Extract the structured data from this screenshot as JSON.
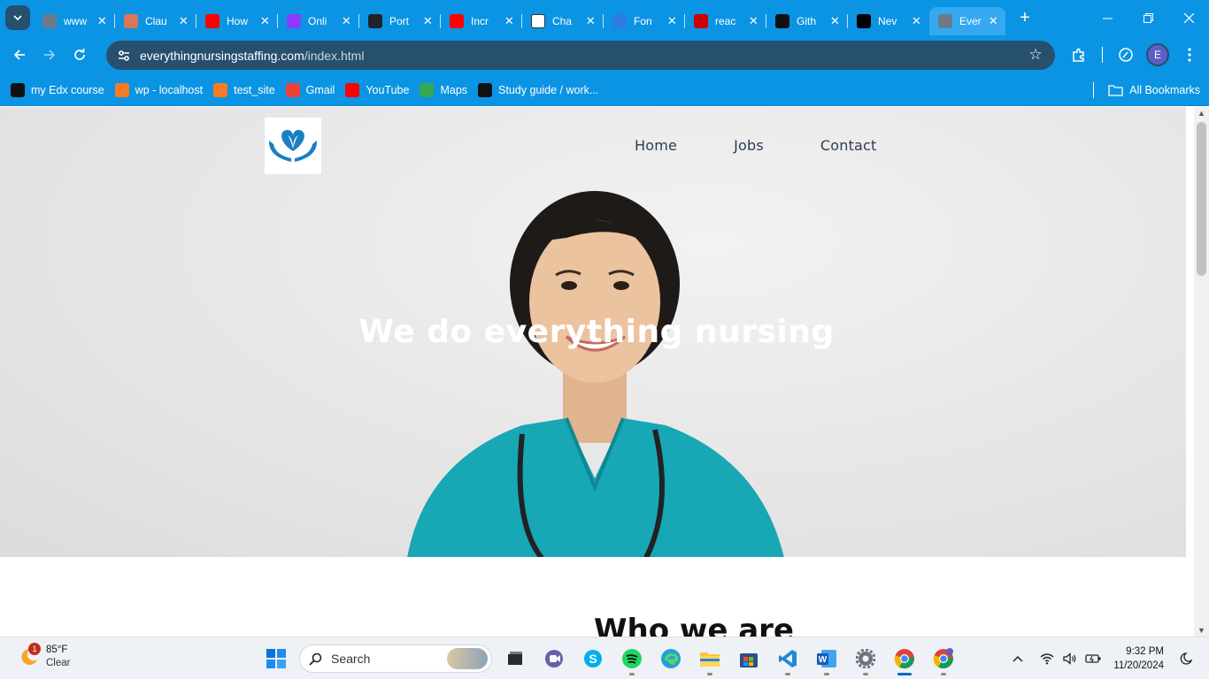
{
  "tabs": [
    {
      "title": "www",
      "favicon": "globe-icon",
      "color": "#6b7b88"
    },
    {
      "title": "Clau",
      "favicon": "claude-icon",
      "color": "#d97757"
    },
    {
      "title": "How",
      "favicon": "youtube-icon",
      "color": "#ff0000"
    },
    {
      "title": "Onli",
      "favicon": "purple-circle-icon",
      "color": "#8b3dff"
    },
    {
      "title": "Port",
      "favicon": "react-icon",
      "color": "#20232a"
    },
    {
      "title": "Incr",
      "favicon": "youtube-icon",
      "color": "#ff0000"
    },
    {
      "title": "Cha",
      "favicon": "chatgpt-icon",
      "color": "#ffffff"
    },
    {
      "title": "Fon",
      "favicon": "flag-icon",
      "color": "#2f7be5"
    },
    {
      "title": "reac",
      "favicon": "n-icon",
      "color": "#cc0000"
    },
    {
      "title": "Gith",
      "favicon": "github-icon",
      "color": "#111111"
    },
    {
      "title": "Nev",
      "favicon": "triangle-icon",
      "color": "#000000"
    },
    {
      "title": "Ever",
      "favicon": "globe-icon",
      "color": "#6b7b88",
      "active": true
    }
  ],
  "address": {
    "domain": "everythingnursingstaffing.com",
    "path": "/index.html"
  },
  "profile_initial": "E",
  "bookmarks": [
    {
      "label": "my Edx course",
      "icon": "x-icon",
      "color": "#111111"
    },
    {
      "label": "wp - localhost",
      "icon": "xampp-icon",
      "color": "#fb7a24"
    },
    {
      "label": "test_site",
      "icon": "xampp-icon",
      "color": "#fb7a24"
    },
    {
      "label": "Gmail",
      "icon": "gmail-icon",
      "color": "#ea4335"
    },
    {
      "label": "YouTube",
      "icon": "youtube-icon",
      "color": "#ff0000"
    },
    {
      "label": "Maps",
      "icon": "maps-icon",
      "color": "#34a853"
    },
    {
      "label": "Study guide / work...",
      "icon": "institution-icon",
      "color": "#111111"
    }
  ],
  "all_bookmarks": "All Bookmarks",
  "site": {
    "nav": [
      "Home",
      "Jobs",
      "Contact"
    ],
    "hero_title": "We do everything nursing",
    "section_title": "Who we are",
    "brand_color": "#1a7fc4",
    "scrub_color": "#18a7b5"
  },
  "taskbar": {
    "weather_temp": "85°F",
    "weather_cond": "Clear",
    "weather_badge": "1",
    "search_label": "Search",
    "apps": [
      "windows-start-icon",
      "task-view-icon",
      "teams-icon",
      "skype-icon",
      "spotify-icon",
      "edge-icon",
      "file-explorer-icon",
      "store-icon",
      "vscode-icon",
      "word-icon",
      "settings-icon",
      "chrome-icon",
      "chrome-profile-icon"
    ],
    "time": "9:32 PM",
    "date": "11/20/2024"
  }
}
